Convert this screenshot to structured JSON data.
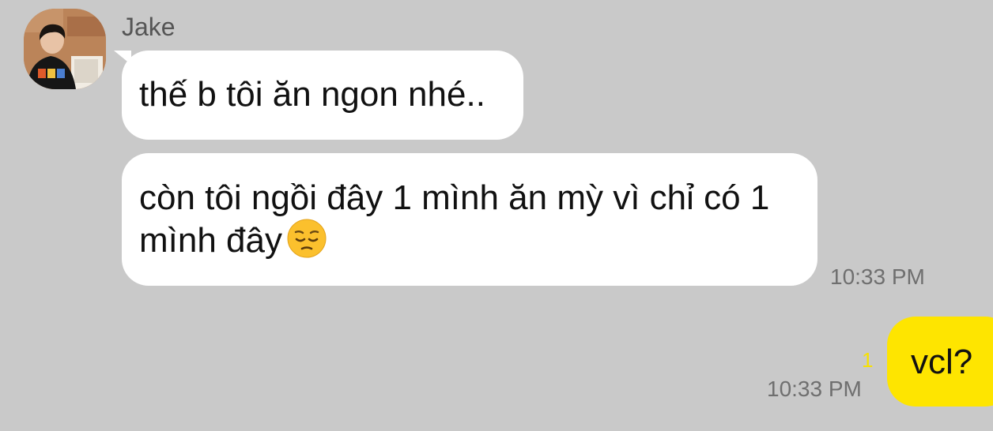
{
  "chat": {
    "sender_name": "Jake",
    "incoming": [
      {
        "text": "thế b tôi ăn ngon nhé.."
      },
      {
        "text": "còn tôi ngồi đây 1 mình ăn mỳ vì chỉ có 1 mình đây"
      }
    ],
    "incoming_emoji": "pensive-face",
    "incoming_time": "10:33 PM",
    "outgoing": {
      "text": "vcl?",
      "time": "10:33 PM",
      "unread_count": "1"
    }
  },
  "colors": {
    "background": "#c9c9c9",
    "incoming_bubble": "#ffffff",
    "outgoing_bubble": "#fee500",
    "unread": "#f7e100"
  }
}
